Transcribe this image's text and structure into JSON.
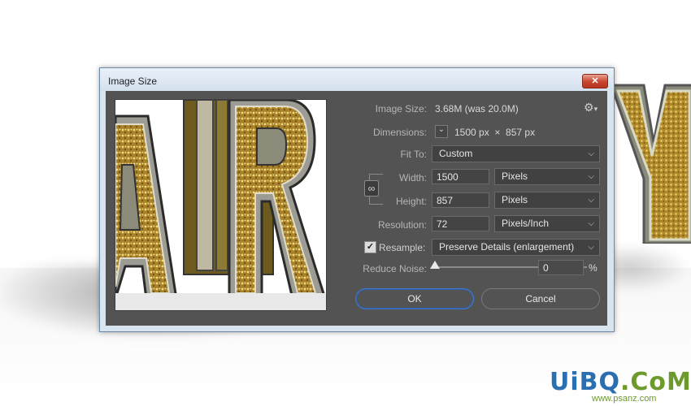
{
  "window": {
    "title": "Image Size",
    "close_glyph": "✕"
  },
  "image_size": {
    "label": "Image Size:",
    "value": "3.68M (was 20.0M)"
  },
  "dimensions": {
    "label": "Dimensions:",
    "value": "1500 px  ×  857 px",
    "chevron": "⌄"
  },
  "fit_to": {
    "label": "Fit To:",
    "value": "Custom"
  },
  "width": {
    "label": "Width:",
    "value": "1500",
    "unit": "Pixels"
  },
  "height": {
    "label": "Height:",
    "value": "857",
    "unit": "Pixels"
  },
  "resolution": {
    "label": "Resolution:",
    "value": "72",
    "unit": "Pixels/Inch"
  },
  "resample": {
    "label": "Resample:",
    "checked": true,
    "check_glyph": "✓",
    "value": "Preserve Details (enlargement)"
  },
  "reduce_noise": {
    "label": "Reduce Noise:",
    "value": "0",
    "unit": "%",
    "level": 0
  },
  "buttons": {
    "ok": "OK",
    "cancel": "Cancel"
  },
  "watermark": {
    "part1": "UiBQ",
    "part2": ".CoM",
    "sub": "www.psanz.com"
  },
  "colors": {
    "dialog_bg": "#535353",
    "gold": "#c9a53a",
    "primary_border": "#3e7ad0"
  }
}
